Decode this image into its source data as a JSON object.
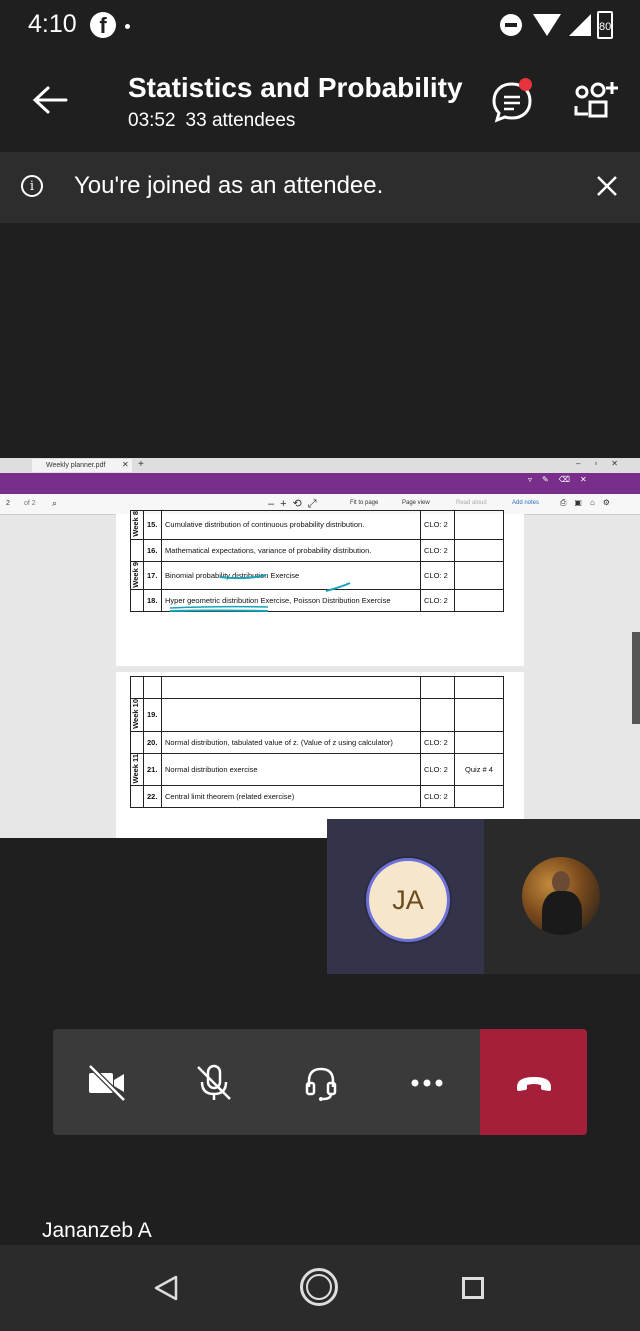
{
  "status_bar": {
    "time": "4:10",
    "battery": "80"
  },
  "header": {
    "title": "Statistics and Probability",
    "duration": "03:52",
    "attendees": "33 attendees"
  },
  "notice": {
    "text": "You're joined as an attendee."
  },
  "shared_screen": {
    "tab_title": "Weekly planner.pdf",
    "page_number": "2",
    "page_total": "of 2",
    "toolbar": {
      "fit": "Fit to page",
      "page_view": "Page view",
      "read_aloud": "Read aloud",
      "add_notes": "Add notes"
    },
    "page1_rows": [
      {
        "week": "Week 8",
        "num": "15.",
        "topic": "Cumulative distribution of continuous probability distribution.",
        "clo": "CLO: 2",
        "quiz": ""
      },
      {
        "week": "",
        "num": "16.",
        "topic": "Mathematical expectations, variance of probability distribution.",
        "clo": "CLO: 2",
        "quiz": ""
      },
      {
        "week": "Week 9",
        "num": "17.",
        "topic": "Binomial probability distribution Exercise",
        "clo": "CLO: 2",
        "quiz": ""
      },
      {
        "week": "",
        "num": "18.",
        "topic": "Hyper geometric distribution Exercise, Poisson Distribution Exercise",
        "clo": "CLO: 2",
        "quiz": ""
      }
    ],
    "page2_rows": [
      {
        "week": "",
        "num": "",
        "topic": "",
        "clo": "",
        "quiz": ""
      },
      {
        "week": "Week 10",
        "num": "19.",
        "topic": "",
        "clo": "",
        "quiz": ""
      },
      {
        "week": "",
        "num": "20.",
        "topic": "Normal distribution, tabulated value of z. (Value of z using calculator)",
        "clo": "CLO: 2",
        "quiz": ""
      },
      {
        "week": "Week 11",
        "num": "21.",
        "topic": "Normal distribution exercise",
        "clo": "CLO: 2",
        "quiz": "Quiz # 4"
      },
      {
        "week": "",
        "num": "22.",
        "topic": "Central limit theorem (related exercise)",
        "clo": "CLO: 2",
        "quiz": ""
      }
    ]
  },
  "participants": {
    "ja_initials": "JA",
    "speaker_name": "Jananzeb A"
  },
  "controls": {
    "camera": "camera-off-icon",
    "mic": "mic-off-icon",
    "audio": "headset-icon",
    "more": "more-icon",
    "hangup": "hang-up-icon",
    "hangup_color": "#a4203a"
  }
}
